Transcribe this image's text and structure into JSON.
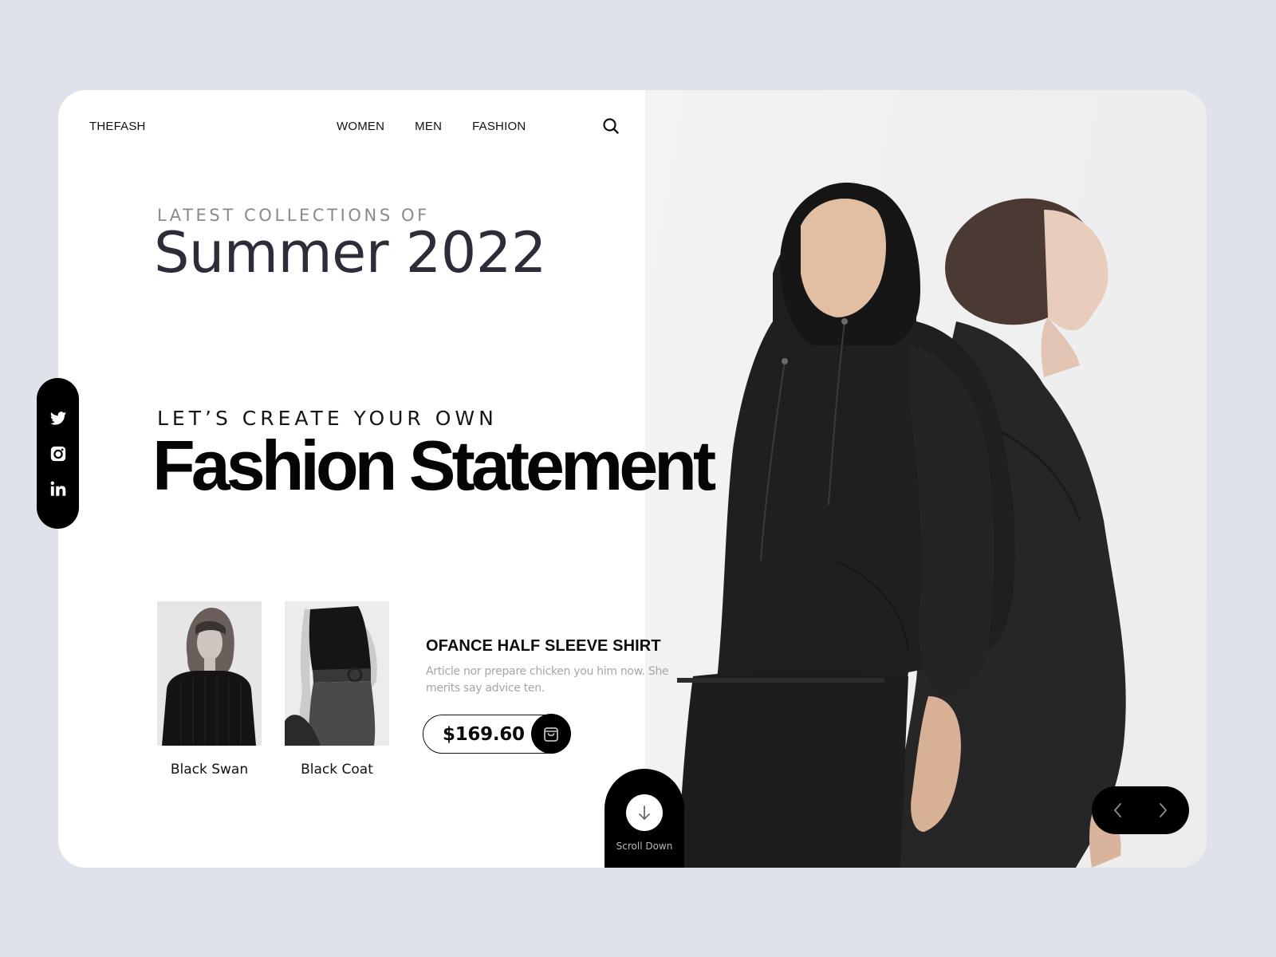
{
  "header": {
    "brand": "THEFASH",
    "nav": [
      {
        "label": "WOMEN"
      },
      {
        "label": "MEN"
      },
      {
        "label": "FASHION"
      }
    ],
    "search_icon": "search-icon"
  },
  "hero": {
    "eyebrow_1": "LATEST COLLECTIONS OF",
    "title_1": "Summer 2022",
    "eyebrow_2": "LET’S CREATE YOUR OWN",
    "title_2": "Fashion Statement",
    "image_alt": "Two models in black hoodies standing back to back"
  },
  "social": [
    {
      "name": "twitter",
      "icon": "twitter-icon"
    },
    {
      "name": "instagram",
      "icon": "instagram-icon"
    },
    {
      "name": "linkedin",
      "icon": "linkedin-icon"
    }
  ],
  "thumbnails": [
    {
      "label": "Black Swan"
    },
    {
      "label": "Black Coat"
    }
  ],
  "product": {
    "name": "OFANCE HALF SLEEVE SHIRT",
    "description": "Article nor prepare chicken you him now. She merits say advice ten.",
    "price": "$169.60",
    "cart_icon": "shopping-bag-icon"
  },
  "scroll": {
    "label": "Scroll Down",
    "icon": "arrow-down-icon"
  },
  "slider": {
    "prev_icon": "chevron-left-icon",
    "next_icon": "chevron-right-icon"
  },
  "colors": {
    "page_bg": "#dfe2ea",
    "card_bg": "#ffffff",
    "accent": "#000000",
    "muted_text": "#8a8a8e",
    "heading_dark": "#2d2c38"
  }
}
